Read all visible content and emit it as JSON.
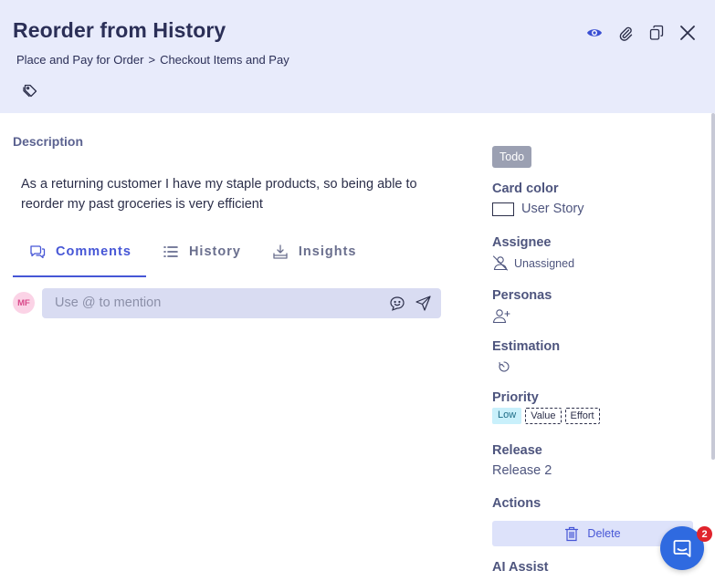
{
  "header": {
    "title": "Reorder from History",
    "breadcrumb": [
      "Place and Pay for Order",
      "Checkout Items and Pay"
    ],
    "breadcrumb_separator": ">",
    "icons": [
      "eye-icon",
      "paperclip-icon",
      "copy-icon",
      "close-icon",
      "tag-icon"
    ]
  },
  "description": {
    "label": "Description",
    "text": "As a returning customer I have my staple products, so being able to reorder my past groceries is very efficient"
  },
  "tabs": [
    {
      "label": "Comments",
      "icon": "comments-icon",
      "active": true
    },
    {
      "label": "History",
      "icon": "list-icon",
      "active": false
    },
    {
      "label": "Insights",
      "icon": "download-tray-icon",
      "active": false
    }
  ],
  "comment": {
    "avatar_initials": "MF",
    "placeholder": "Use @ to mention"
  },
  "sidebar": {
    "status": "Todo",
    "card_color_label": "Card color",
    "card_color_value": "User Story",
    "assignee_label": "Assignee",
    "assignee_value": "Unassigned",
    "personas_label": "Personas",
    "estimation_label": "Estimation",
    "priority_label": "Priority",
    "priority_value": "Low",
    "priority_value_box": "Value",
    "priority_effort_box": "Effort",
    "release_label": "Release",
    "release_value": "Release 2",
    "actions_label": "Actions",
    "delete_label": "Delete",
    "ai_assist_label": "AI Assist"
  },
  "chat": {
    "badge_count": "2"
  },
  "colors": {
    "header_bg": "#e8ebfb",
    "accent": "#4656d6",
    "status_bg": "#9ba0b2",
    "low_priority_bg": "#c9f0fb",
    "chat_button": "#2f6ae0",
    "badge_red": "#e0242d"
  }
}
